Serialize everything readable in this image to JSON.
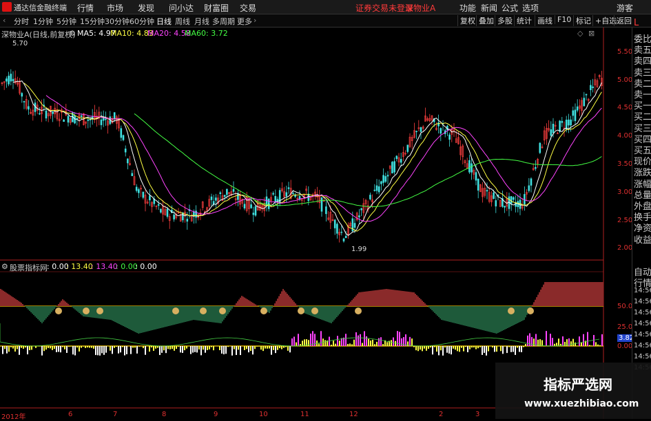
{
  "titlebar": {
    "app_name": "通达信金融终端",
    "menus": [
      "行情",
      "市场",
      "发现",
      "问小达",
      "财富圈",
      "交易"
    ],
    "notice": "证券交易未登录",
    "stock": "深物业A",
    "right_menus": [
      "功能",
      "新闻",
      "公式",
      "选项"
    ],
    "user": "游客"
  },
  "toolbar": {
    "periods": [
      "分时",
      "1分钟",
      "5分钟",
      "15分钟",
      "30分钟",
      "60分钟",
      "日线",
      "周线",
      "月线",
      "多周期",
      "更多"
    ],
    "active_period": "日线",
    "right_buttons": [
      "复权",
      "叠加",
      "多股",
      "统计",
      "画线",
      "F10",
      "标记",
      "+自选",
      "返回"
    ]
  },
  "main_chart": {
    "title": "深物业A(日线,前复权)",
    "ma": [
      {
        "label": "MA5: 4.97",
        "color": "#ffffff"
      },
      {
        "label": "MA10: 4.83",
        "color": "#ffff44"
      },
      {
        "label": "MA20: 4.58",
        "color": "#ff44ff"
      },
      {
        "label": "MA60: 3.72",
        "color": "#44ff44"
      }
    ],
    "high_label": "5.70",
    "low_label": "1.99",
    "y_ticks": [
      "5.50",
      "5.00",
      "4.50",
      "4.00",
      "3.50",
      "3.00",
      "2.50",
      "2.00"
    ]
  },
  "indicator": {
    "title": "股票指标网",
    "values": [
      {
        "label": ": 0.00",
        "color": "#ffffff"
      },
      {
        "label": ": 13.40",
        "color": "#ffff44"
      },
      {
        "label": ": 13.40",
        "color": "#ff44ff"
      },
      {
        "label": ": 0.00",
        "color": "#44ff44"
      },
      {
        "label": ": 0.00",
        "color": "#ffffff"
      }
    ],
    "y_ticks": [
      "50.00",
      "25.00",
      "3.82",
      "0.00"
    ]
  },
  "x_axis": [
    "2012年",
    "6",
    "7",
    "8",
    "9",
    "10",
    "11",
    "12",
    "2",
    "3"
  ],
  "right_panel": {
    "top_tag": "L",
    "items": [
      "委比",
      "卖五",
      "卖四",
      "卖三",
      "卖二",
      "卖一",
      "买一",
      "买二",
      "买三",
      "买四",
      "买五",
      "现价",
      "涨跌",
      "涨幅",
      "总量",
      "外盘",
      "换手",
      "净资",
      "收益"
    ],
    "bottom_items": [
      "自动",
      "行情",
      "14:56",
      "14:56",
      "14:56",
      "14:56",
      "14:56",
      "14:56",
      "14:56",
      "14:56"
    ]
  },
  "watermark": {
    "line1": "指标严选网",
    "line2": "www.xuezhibiao.com"
  }
}
